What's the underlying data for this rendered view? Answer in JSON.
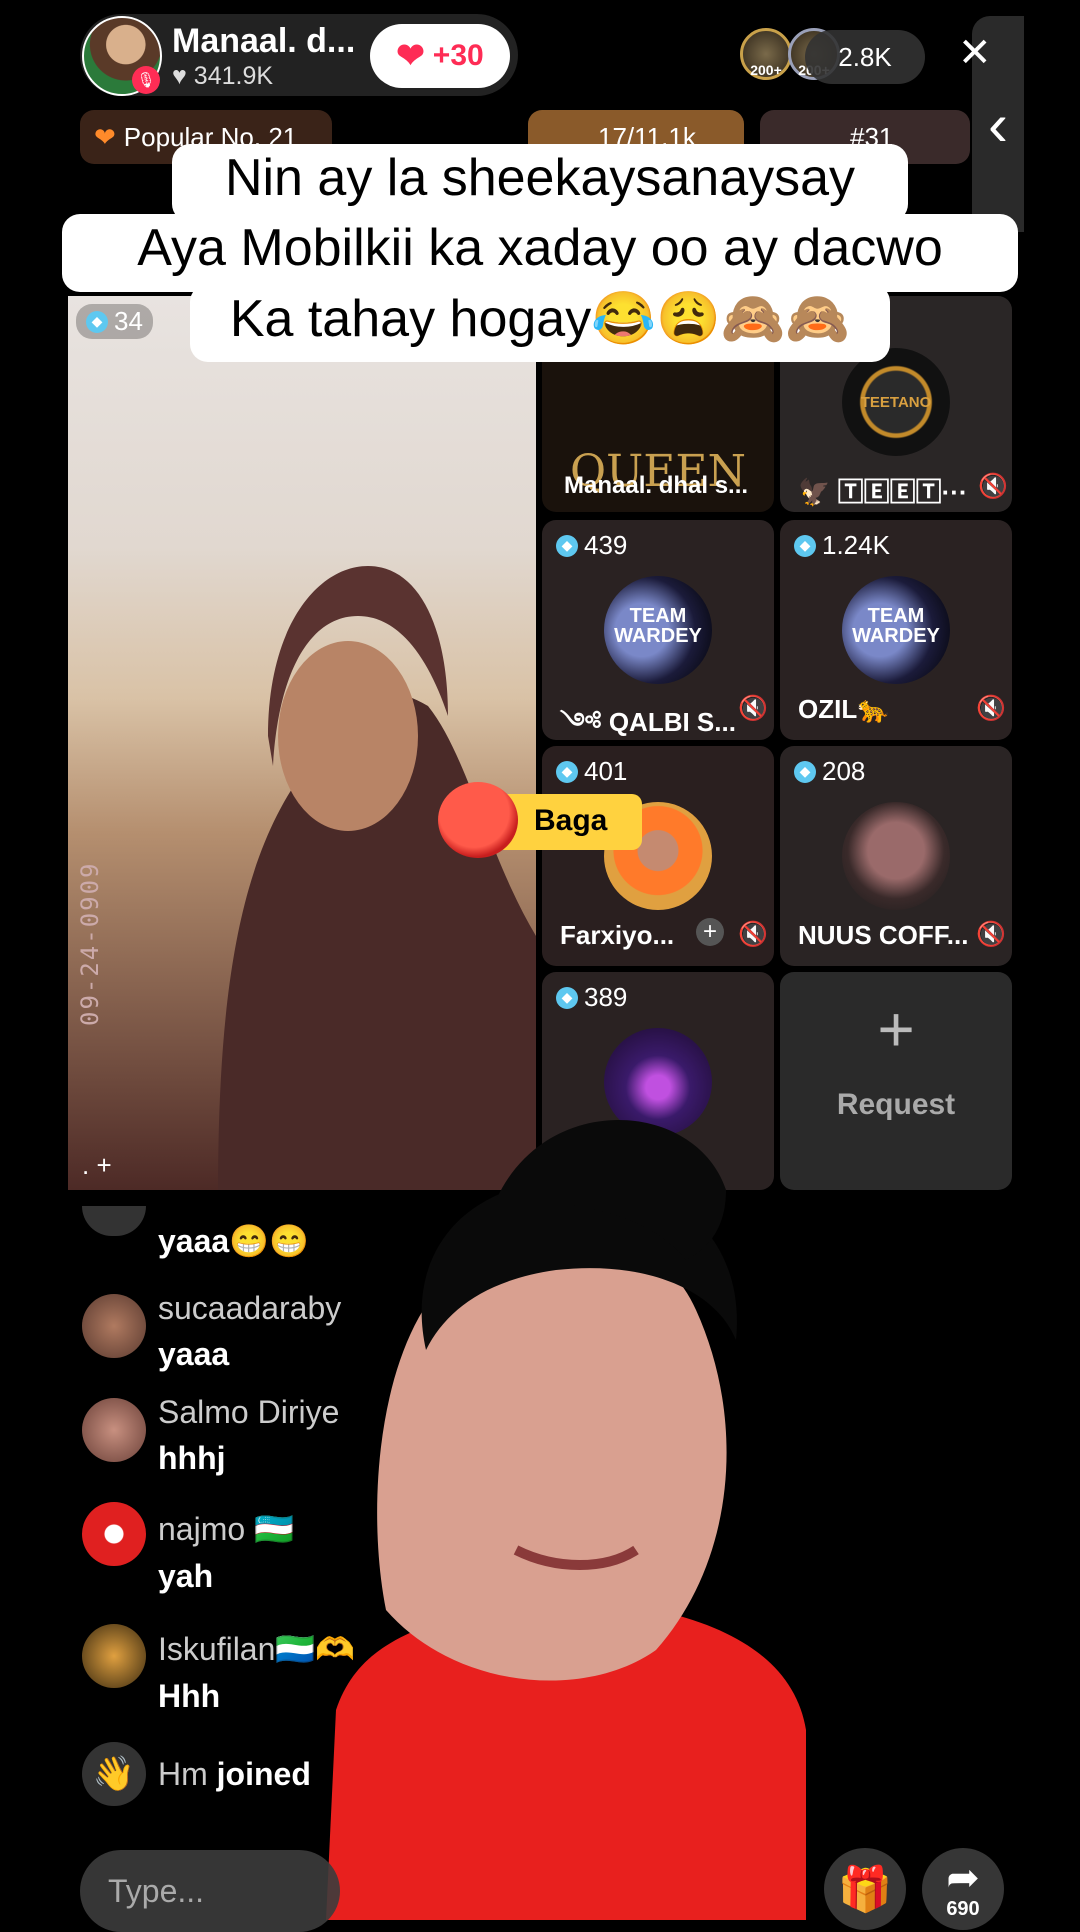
{
  "header": {
    "host_name": "Manaal. d...",
    "host_likes": "341.9K",
    "follow_label": "+30",
    "viewer_badges": [
      "200+",
      "200+"
    ],
    "viewer_count": "2.8K",
    "close": "✕"
  },
  "ranks": {
    "popular": "Popular No. 21",
    "middle": "17/11.1k",
    "right": "#31"
  },
  "caption": {
    "line1": "Nin ay la sheekaysanaysay",
    "line2": "Aya Mobilkii ka xaday oo ay dacwo",
    "line3": "Ka tahay hogay😂😩🙈🙈"
  },
  "main_video": {
    "badge": "34",
    "timestamp": "09-24-0909",
    "add_label": ". +"
  },
  "tiles": [
    {
      "name": "Manaal. dhal s...",
      "logo_text": "QUEEN"
    },
    {
      "name": "🦅 🅃🄴🄴🅃···",
      "logo_text": "TEETANO"
    },
    {
      "badge": "439",
      "name": "༺ QALBI S...",
      "logo_text": "TEAM WARDEY"
    },
    {
      "badge": "1.24K",
      "name": "OZIL🐆",
      "logo_text": "TEAM WARDEY"
    },
    {
      "badge": "401",
      "name": "Farxiyo...",
      "plus": "+"
    },
    {
      "badge": "208",
      "name": "NUUS COFF..."
    },
    {
      "badge": "389",
      "name": ""
    },
    {
      "request_label": "Request",
      "request_plus": "+"
    }
  ],
  "gift_popup": {
    "label": "Baga"
  },
  "comments": [
    {
      "user": "",
      "text": "yaaa😁😁"
    },
    {
      "user": "sucaadaraby",
      "text": "yaaa"
    },
    {
      "user": "Salmo Diriye",
      "text": "hhhj"
    },
    {
      "user": "najmo 🇺🇿",
      "text": "yah"
    },
    {
      "user": "Iskufilan🇸🇱🫶",
      "text": "Hhh"
    },
    {
      "user": "Hm",
      "text": "joined"
    }
  ],
  "input": {
    "placeholder": "Type..."
  },
  "share_count": "690",
  "colors": {
    "accent": "#fe2c55",
    "badge": "#5ec8f0",
    "gift_bg": "#ffd23f"
  }
}
